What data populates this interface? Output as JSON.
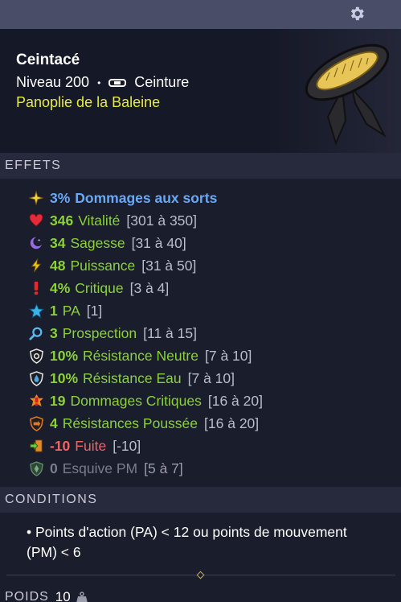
{
  "item": {
    "name": "Ceintacé",
    "level_label": "Niveau 200",
    "separator": "•",
    "type": "Ceinture",
    "set": "Panoplie de la Baleine",
    "image_icon": "belt-item-image"
  },
  "sections": {
    "effects_title": "EFFETS",
    "conditions_title": "CONDITIONS",
    "weight_label": "POIDS",
    "weight_value": "10"
  },
  "effects": [
    {
      "icon": "star-icon",
      "value": "3%",
      "name": "Dommages aux sorts",
      "range": ""
    },
    {
      "icon": "heart-icon",
      "value": "346",
      "name": "Vitalité",
      "range": "[301 à 350]"
    },
    {
      "icon": "wisdom-icon",
      "value": "34",
      "name": "Sagesse",
      "range": "[31 à 40]"
    },
    {
      "icon": "power-icon",
      "value": "48",
      "name": "Puissance",
      "range": "[31 à 50]"
    },
    {
      "icon": "critical-icon",
      "value": "4%",
      "name": "Critique",
      "range": "[3 à 4]"
    },
    {
      "icon": "ap-star-icon",
      "value": "1",
      "name": "PA",
      "range": "[1]"
    },
    {
      "icon": "prospection-icon",
      "value": "3",
      "name": "Prospection",
      "range": "[11 à 15]"
    },
    {
      "icon": "neutral-resist-icon",
      "value": "10%",
      "name": "Résistance Neutre",
      "range": "[7 à 10]"
    },
    {
      "icon": "water-resist-icon",
      "value": "10%",
      "name": "Résistance Eau",
      "range": "[7 à 10]"
    },
    {
      "icon": "critical-damage-icon",
      "value": "19",
      "name": "Dommages Critiques",
      "range": "[16 à 20]"
    },
    {
      "icon": "pushback-resist-icon",
      "value": "4",
      "name": "Résistances Poussée",
      "range": "[16 à 20]"
    },
    {
      "icon": "flee-icon",
      "value": "-10",
      "name": "Fuite",
      "range": "[-10]"
    },
    {
      "icon": "mp-dodge-icon",
      "value": "0",
      "name": "Esquive PM",
      "range": "[5 à 7]"
    }
  ],
  "conditions": [
    "• Points d'action (PA) < 12 ou points de mouvement (PM) < 6"
  ],
  "colors": {
    "positive": "#8ad13d",
    "highlight": "#6aa8f6",
    "negative": "#f26464",
    "disabled": "#7a7d8c",
    "set": "#e6ec3e"
  }
}
